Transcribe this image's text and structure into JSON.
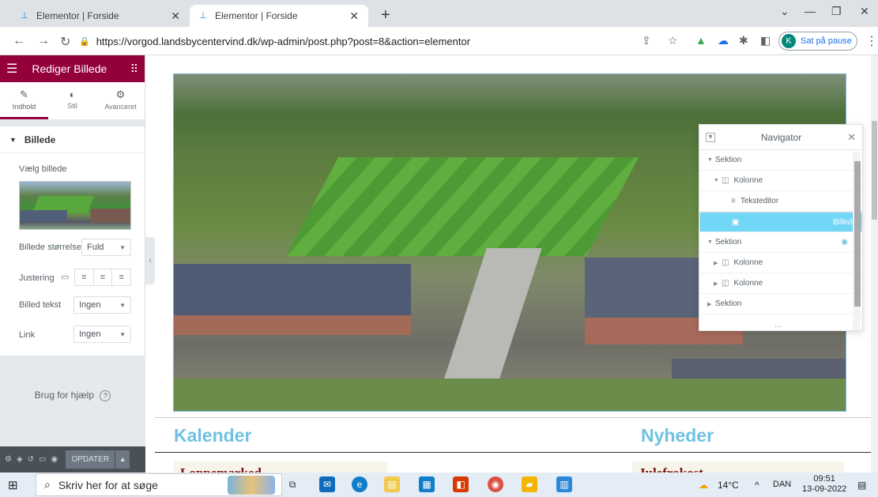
{
  "browser": {
    "tabs": [
      {
        "title": "Elementor | Forside",
        "active": false
      },
      {
        "title": "Elementor | Forside",
        "active": true
      }
    ],
    "url": "https://vorgod.landsbycentervind.dk/wp-admin/post.php?post=8&action=elementor",
    "profile_initial": "K",
    "profile_status": "Sat på pause"
  },
  "panel": {
    "title": "Rediger Billede",
    "tabs": [
      {
        "label": "Indhold",
        "icon": "pencil-icon",
        "active": true
      },
      {
        "label": "Stil",
        "icon": "contrast-icon",
        "active": false
      },
      {
        "label": "Avanceret",
        "icon": "gear-icon",
        "active": false
      }
    ],
    "section_title": "Billede",
    "choose_image_label": "Vælg billede",
    "image_size_label": "Billede størrelse",
    "image_size_value": "Fuld",
    "alignment_label": "Justering",
    "caption_label": "Billed tekst",
    "caption_value": "Ingen",
    "link_label": "Link",
    "link_value": "Ingen",
    "help_text": "Brug for hjælp",
    "update_label": "OPDATER"
  },
  "canvas": {
    "left_heading": "Kalender",
    "right_heading": "Nyheder",
    "left_card_title": "Loppemarked",
    "right_card_title": "Julefrokost"
  },
  "navigator": {
    "title": "Navigator",
    "items": [
      {
        "label": "Sektion",
        "level": 0,
        "icon": "",
        "expanded": true,
        "selected": false
      },
      {
        "label": "Kolonne",
        "level": 1,
        "icon": "column-icon",
        "expanded": true,
        "selected": false
      },
      {
        "label": "Teksteditor",
        "level": 2,
        "icon": "text-editor-icon",
        "expanded": false,
        "selected": false
      },
      {
        "label": "Billede",
        "level": 2,
        "icon": "image-icon",
        "expanded": false,
        "selected": true
      },
      {
        "label": "Sektion",
        "level": 0,
        "icon": "",
        "expanded": true,
        "selected": false,
        "eye": true
      },
      {
        "label": "Kolonne",
        "level": 1,
        "icon": "column-icon",
        "expanded": false,
        "selected": false
      },
      {
        "label": "Kolonne",
        "level": 1,
        "icon": "column-icon",
        "expanded": false,
        "selected": false
      },
      {
        "label": "Sektion",
        "level": 0,
        "icon": "",
        "expanded": false,
        "selected": false
      }
    ]
  },
  "taskbar": {
    "search_placeholder": "Skriv her for at søge",
    "temperature": "14°C",
    "language": "DAN",
    "time": "09:51",
    "date": "13-09-2022"
  }
}
